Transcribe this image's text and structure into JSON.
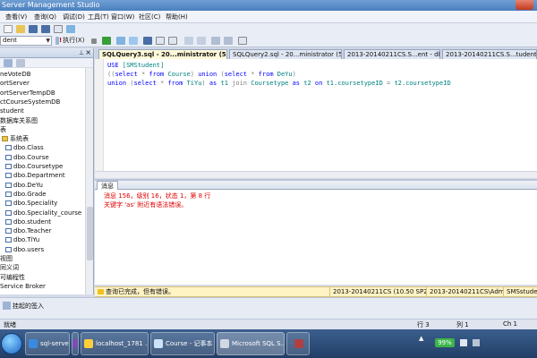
{
  "window": {
    "title": "Server Management Studio"
  },
  "menu": [
    {
      "label": "查看(V)"
    },
    {
      "label": "查询(Q)"
    },
    {
      "label": "调试(D)"
    },
    {
      "label": "工具(T)"
    },
    {
      "label": "窗口(W)"
    },
    {
      "label": "社区(C)"
    },
    {
      "label": "帮助(H)"
    }
  ],
  "toolbar": {
    "database": "dent",
    "execute_label": "执行(X)"
  },
  "explorer": {
    "items": [
      {
        "label": "neVoteDB",
        "icon": "database-icon"
      },
      {
        "label": "ortServer",
        "icon": "database-icon"
      },
      {
        "label": "ortServerTempDB",
        "icon": "database-icon"
      },
      {
        "label": "ctCourseSystemDB",
        "icon": "database-icon"
      },
      {
        "label": "student",
        "icon": "database-icon"
      },
      {
        "label": "数据库关系图",
        "icon": "folder-icon"
      },
      {
        "label": "表",
        "icon": "folder-icon"
      },
      {
        "label": "系统表",
        "icon": "folder-icon"
      },
      {
        "label": "dbo.Class",
        "icon": "table-icon"
      },
      {
        "label": "dbo.Course",
        "icon": "table-icon"
      },
      {
        "label": "dbo.Coursetype",
        "icon": "table-icon"
      },
      {
        "label": "dbo.Department",
        "icon": "table-icon"
      },
      {
        "label": "dbo.DeYu",
        "icon": "table-icon"
      },
      {
        "label": "dbo.Grade",
        "icon": "table-icon"
      },
      {
        "label": "dbo.Speciality",
        "icon": "table-icon"
      },
      {
        "label": "dbo.Speciality_course",
        "icon": "table-icon"
      },
      {
        "label": "dbo.student",
        "icon": "table-icon"
      },
      {
        "label": "dbo.Teacher",
        "icon": "table-icon"
      },
      {
        "label": "dbo.TiYu",
        "icon": "table-icon"
      },
      {
        "label": "dbo.users",
        "icon": "table-icon"
      },
      {
        "label": "视图",
        "icon": "folder-icon"
      },
      {
        "label": "同义词",
        "icon": "folder-icon"
      },
      {
        "label": "可编程性",
        "icon": "folder-icon"
      },
      {
        "label": "Service Broker",
        "icon": "folder-icon"
      }
    ]
  },
  "tabs": [
    {
      "label": "SQLQuery3.sql - 20...ministrator (53))*"
    },
    {
      "label": "SQLQuery2.sql - 20...ministrator (55))*"
    },
    {
      "label": "2013-20140211CS.S...ent - dbo.student"
    },
    {
      "label": "2013-20140211CS.S...tudent - dbo.Grade"
    }
  ],
  "editor": {
    "lines": [
      [
        {
          "t": "USE ",
          "c": "kw"
        },
        {
          "t": "[SMStudent]",
          "c": "id"
        }
      ],
      [
        {
          "t": "((",
          "c": "gr"
        },
        {
          "t": "select ",
          "c": "kw"
        },
        {
          "t": "* ",
          "c": "gr"
        },
        {
          "t": "from ",
          "c": "kw"
        },
        {
          "t": "Course",
          "c": "id"
        },
        {
          "t": ") ",
          "c": "gr"
        },
        {
          "t": "union ",
          "c": "kw"
        },
        {
          "t": "(",
          "c": "gr"
        },
        {
          "t": "select ",
          "c": "kw"
        },
        {
          "t": "* ",
          "c": "gr"
        },
        {
          "t": "from ",
          "c": "kw"
        },
        {
          "t": "DeYu",
          "c": "id"
        },
        {
          "t": ")",
          "c": "gr"
        }
      ],
      [
        {
          "t": "union ",
          "c": "kw"
        },
        {
          "t": "(",
          "c": "gr"
        },
        {
          "t": "select ",
          "c": "kw"
        },
        {
          "t": "* ",
          "c": "gr"
        },
        {
          "t": "from ",
          "c": "kw"
        },
        {
          "t": "TiYu",
          "c": "id"
        },
        {
          "t": ") ",
          "c": "gr"
        },
        {
          "t": "as ",
          "c": "kw"
        },
        {
          "t": "t1 ",
          "c": "id"
        },
        {
          "t": "join ",
          "c": "gr"
        },
        {
          "t": "Coursetype ",
          "c": "id"
        },
        {
          "t": "as ",
          "c": "kw"
        },
        {
          "t": "t2 ",
          "c": "id"
        },
        {
          "t": "on ",
          "c": "kw"
        },
        {
          "t": "t1.coursetypeID ",
          "c": "id"
        },
        {
          "t": "= ",
          "c": "gr"
        },
        {
          "t": "t2.coursetypeID",
          "c": "id"
        }
      ]
    ]
  },
  "results": {
    "tab_label": "消息",
    "messages": [
      "消息 156，级别 16，状态 1，第 8 行",
      "关键字 'as' 附近有语法错误。"
    ]
  },
  "query_status": {
    "message": "查询已完成，但有错误。",
    "server": "2013-20140211CS (10.50 SP2)",
    "login": "2013-20140211CS\\Admini...",
    "database": "SMSstudent"
  },
  "statusbar": {
    "ready": "就绪",
    "row": "行 3",
    "col": "列 1",
    "ch": "Ch 1"
  },
  "solution_bar": {
    "label": "挂起的签入"
  },
  "taskbar": {
    "items": [
      {
        "label": "sql-server-求助..."
      },
      {
        "label": "localhost_1781 ..."
      },
      {
        "label": "Course - 记事本"
      },
      {
        "label": "Microsoft SQL S..."
      },
      {
        "label": ""
      }
    ],
    "battery": "99%"
  },
  "colors": {
    "error_text": "#e00000",
    "keyword": "#0000ff",
    "identifier": "#008080",
    "status_bar": "#fff3c4"
  }
}
